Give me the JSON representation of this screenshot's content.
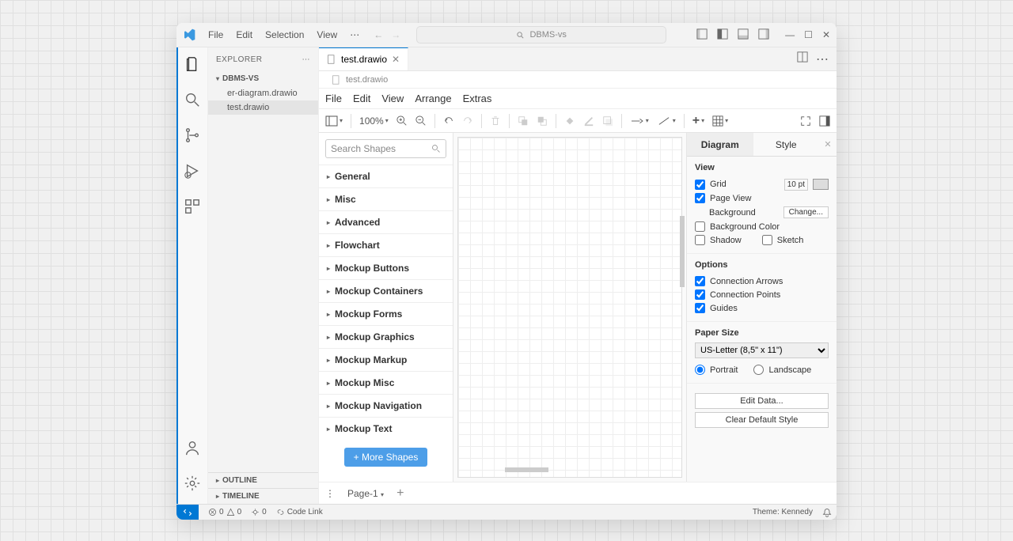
{
  "title_search": "DBMS-vs",
  "menu": [
    "File",
    "Edit",
    "Selection",
    "View"
  ],
  "explorer": {
    "title": "EXPLORER",
    "project": "DBMS-VS",
    "files": [
      "er-diagram.drawio",
      "test.drawio"
    ],
    "outline": "OUTLINE",
    "timeline": "TIMELINE"
  },
  "tab": {
    "label": "test.drawio"
  },
  "breadcrumb": "test.drawio",
  "drawio_menu": [
    "File",
    "Edit",
    "View",
    "Arrange",
    "Extras"
  ],
  "zoom": "100%",
  "shapes": {
    "search_placeholder": "Search Shapes",
    "categories": [
      "General",
      "Misc",
      "Advanced",
      "Flowchart",
      "Mockup Buttons",
      "Mockup Containers",
      "Mockup Forms",
      "Mockup Graphics",
      "Mockup Markup",
      "Mockup Misc",
      "Mockup Navigation",
      "Mockup Text"
    ],
    "more": "More Shapes"
  },
  "pages": {
    "current": "Page-1"
  },
  "panel": {
    "tabs": [
      "Diagram",
      "Style"
    ],
    "view": {
      "title": "View",
      "grid": "Grid",
      "grid_val": "10 pt",
      "pageview": "Page View",
      "background": "Background",
      "change": "Change...",
      "bgcolor": "Background Color",
      "shadow": "Shadow",
      "sketch": "Sketch"
    },
    "options": {
      "title": "Options",
      "conn_arrows": "Connection Arrows",
      "conn_points": "Connection Points",
      "guides": "Guides"
    },
    "paper": {
      "title": "Paper Size",
      "size": "US-Letter (8,5\" x 11\")",
      "portrait": "Portrait",
      "landscape": "Landscape"
    },
    "edit_data": "Edit Data...",
    "clear_style": "Clear Default Style"
  },
  "status": {
    "errors": "0",
    "warnings": "0",
    "ports": "0",
    "codelink": "Code Link",
    "theme": "Theme: Kennedy"
  }
}
